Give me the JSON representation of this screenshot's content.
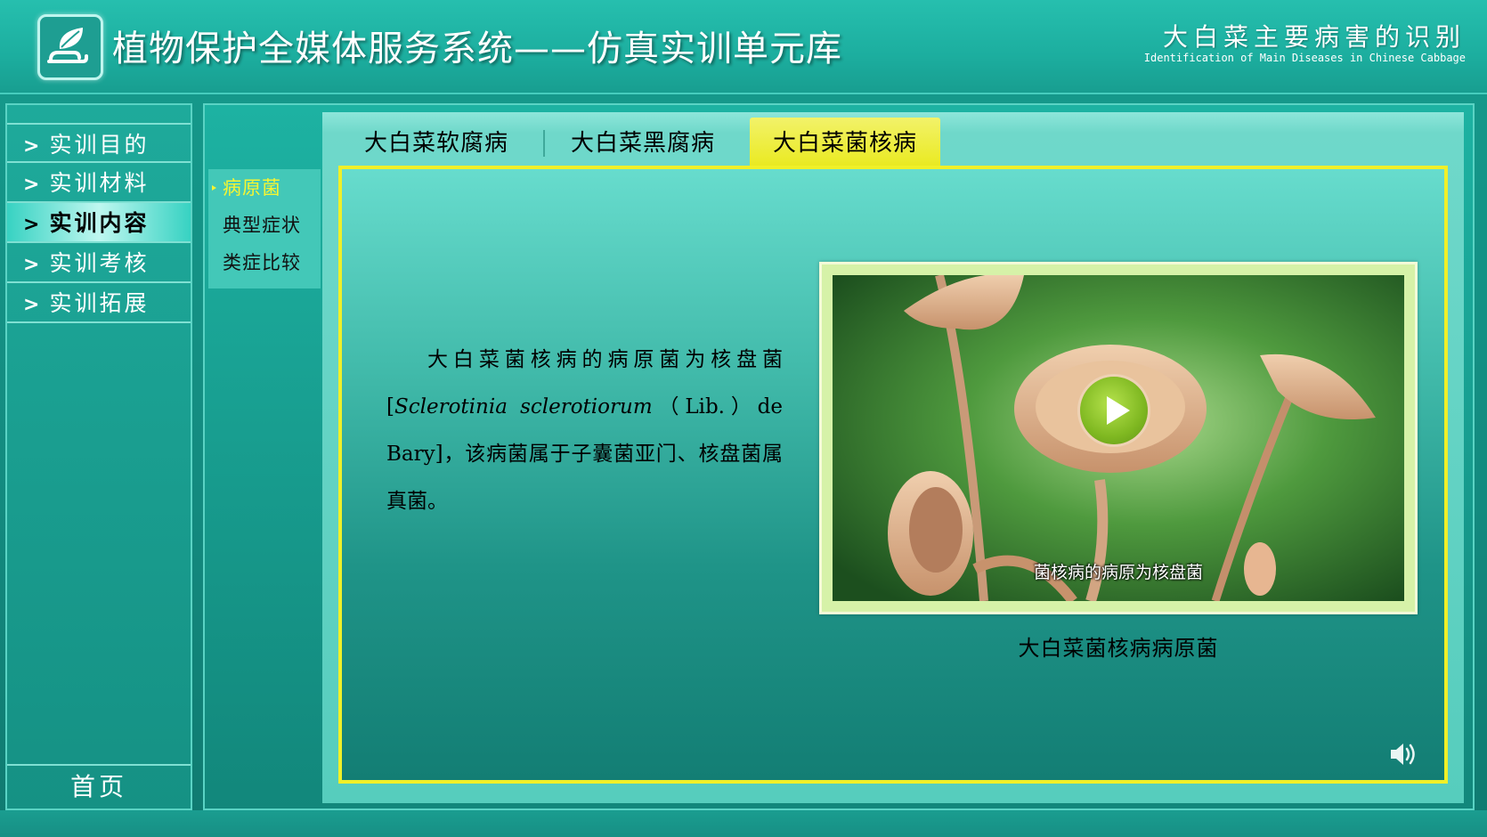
{
  "header": {
    "app_title": "植物保护全媒体服务系统——仿真实训单元库",
    "unit_title": "大白菜主要病害的识别",
    "unit_subtitle": "Identification  of Main Diseases in Chinese Cabbage",
    "logo_icon": "leaf-in-hand-icon"
  },
  "left_nav": {
    "items": [
      {
        "label": "实训目的",
        "active": false
      },
      {
        "label": "实训材料",
        "active": false
      },
      {
        "label": "实训内容",
        "active": true
      },
      {
        "label": "实训考核",
        "active": false
      },
      {
        "label": "实训拓展",
        "active": false
      }
    ],
    "chevron": ">",
    "home_label": "首页"
  },
  "sub_nav": {
    "items": [
      {
        "label": "病原菌",
        "active": true
      },
      {
        "label": "典型症状",
        "active": false
      },
      {
        "label": "类症比较",
        "active": false
      }
    ]
  },
  "tabs": [
    {
      "label": "大白菜软腐病",
      "active": false
    },
    {
      "label": "大白菜黑腐病",
      "active": false
    },
    {
      "label": "大白菜菌核病",
      "active": true
    }
  ],
  "content": {
    "text_lead": "大白菜菌核病的病原菌为核盘菌[",
    "scientific_name": "Sclerotinia sclerotiorum",
    "text_tail": "（Lib.）de Bary]，该病菌属于子囊菌亚门、核盘菌属真菌。"
  },
  "media": {
    "video_subtitle": "菌核病的病原为核盘菌",
    "caption": "大白菜菌核病病原菌",
    "play_icon": "play-icon",
    "sound_icon": "speaker-icon"
  },
  "colors": {
    "accent_yellow": "#f0f028",
    "teal": "#1aa596",
    "active_nav": "#bff7f0"
  }
}
